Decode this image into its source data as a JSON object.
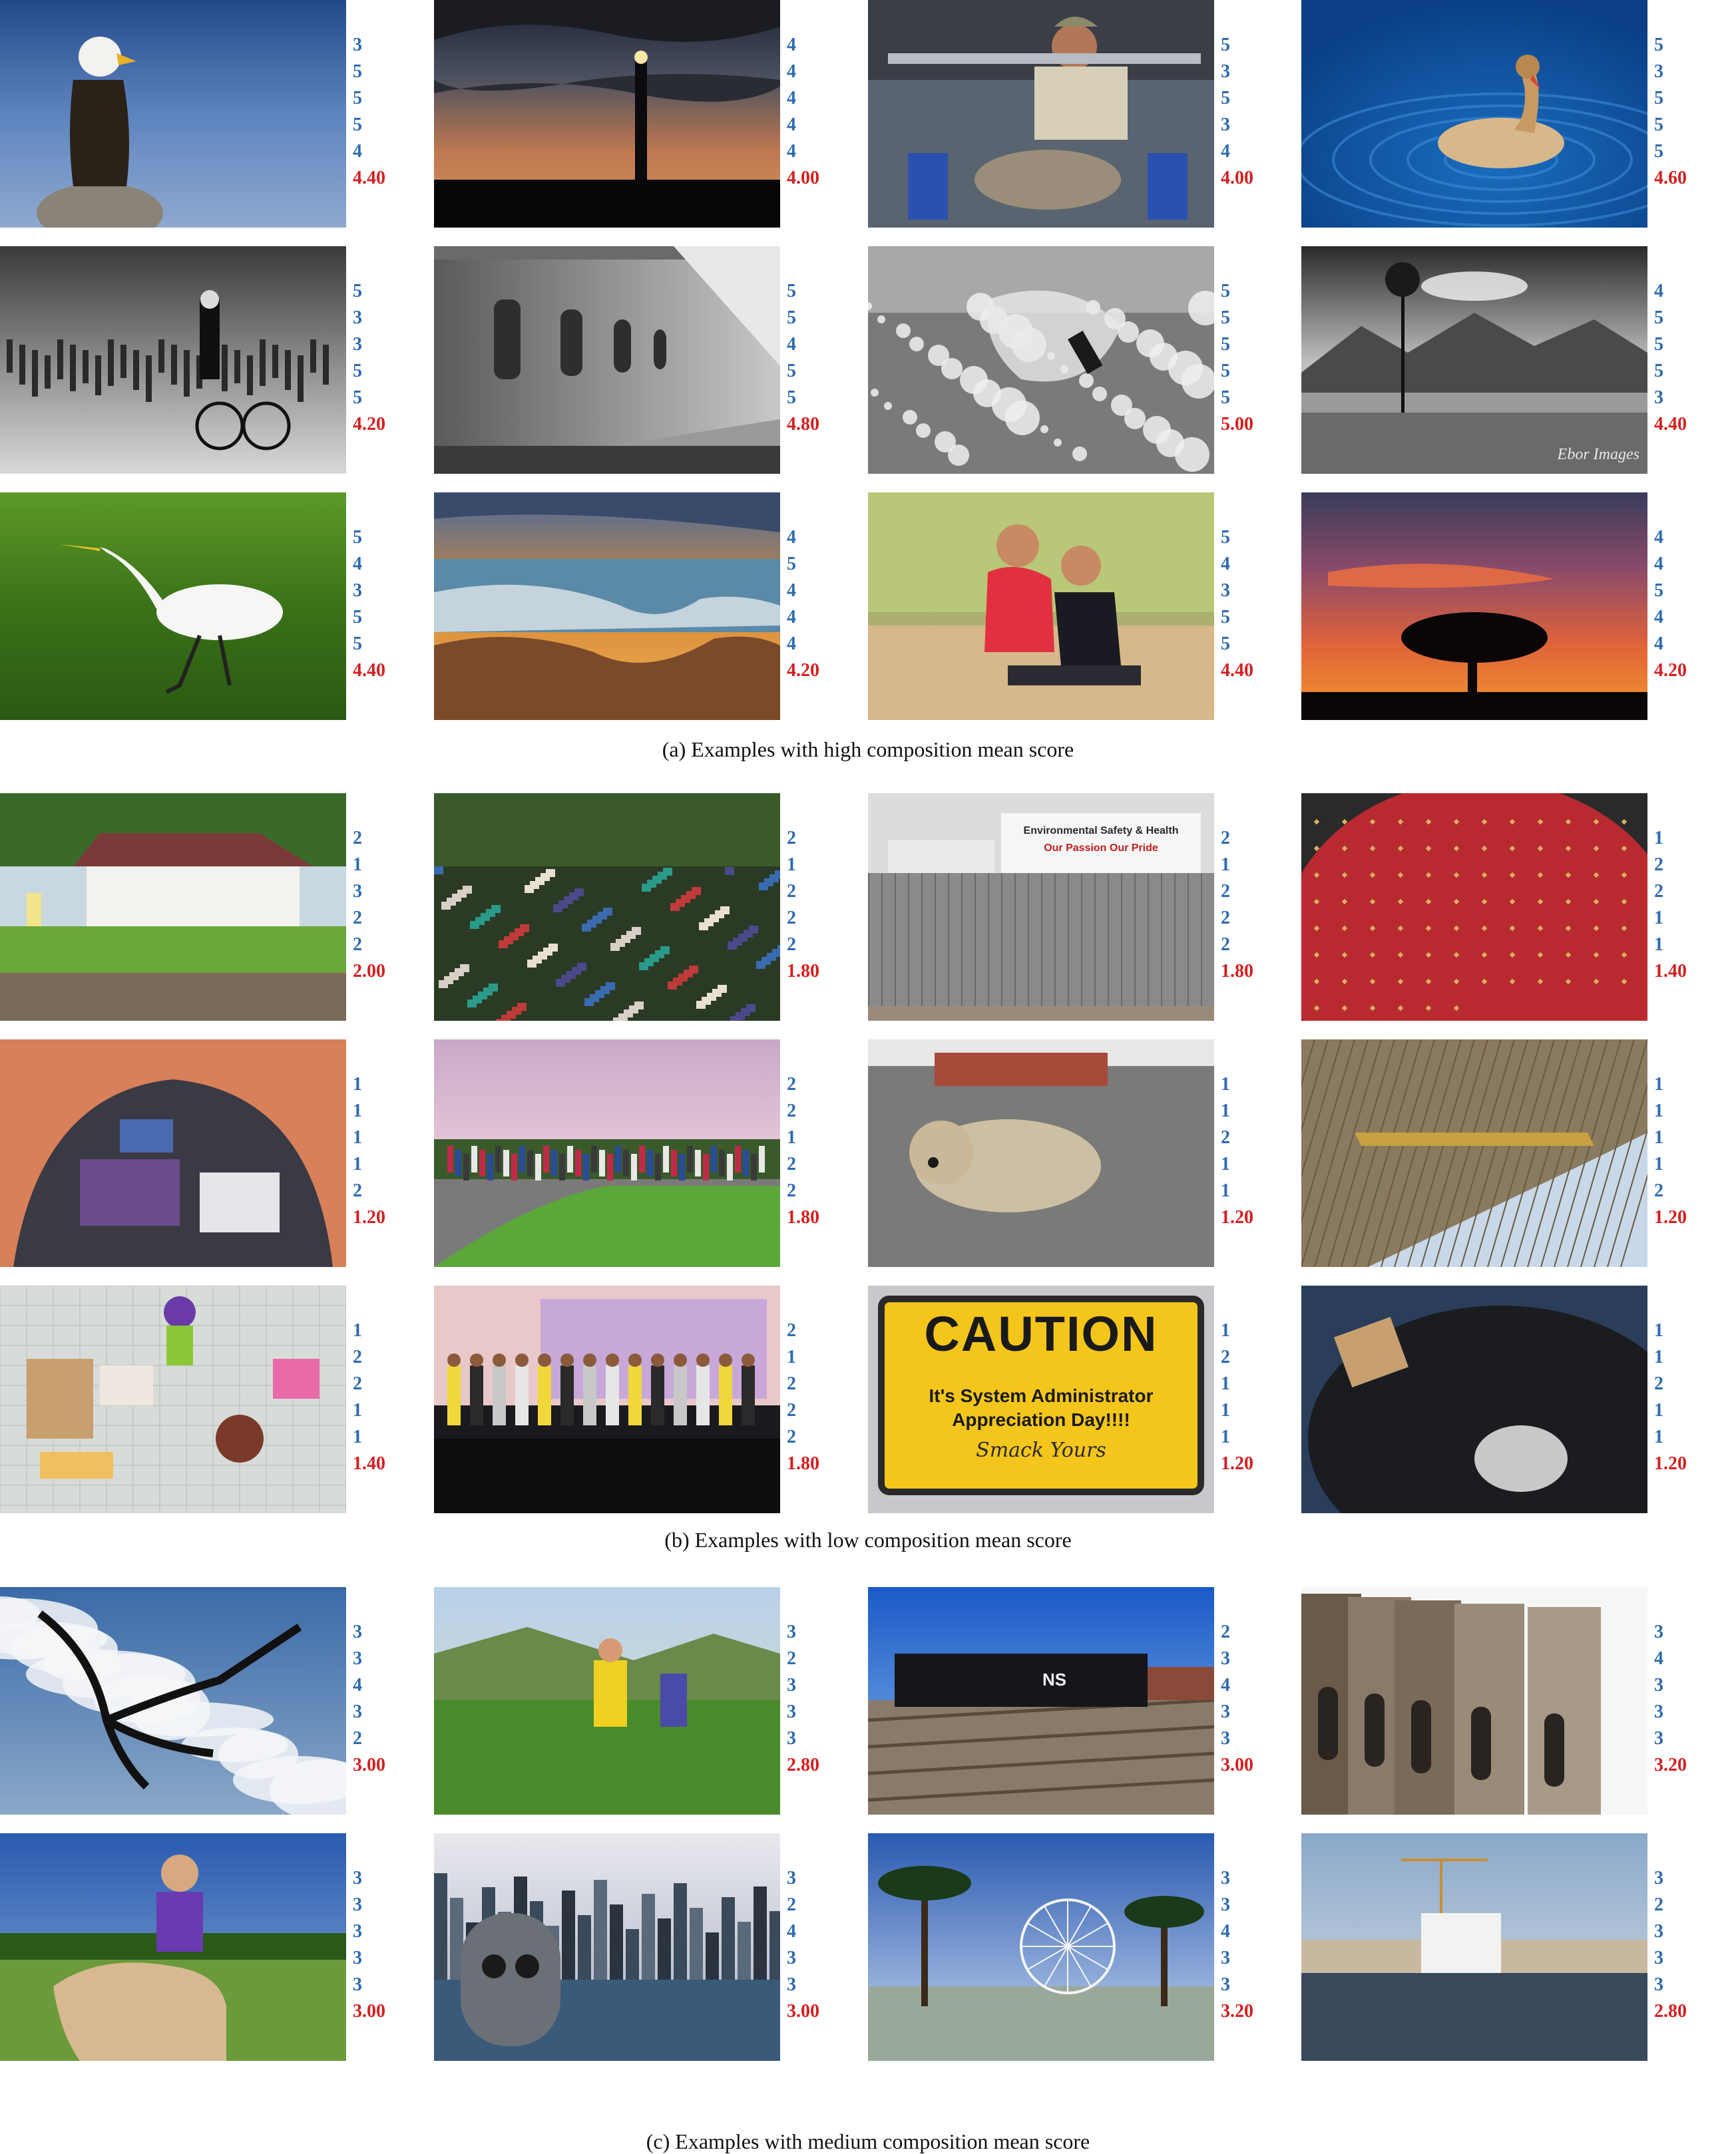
{
  "sections": [
    {
      "caption": "(a) Examples with high composition mean score",
      "rows": [
        [
          {
            "scene": "bald-eagle-on-rock",
            "scores": [
              "3",
              "5",
              "5",
              "5",
              "4"
            ],
            "mean": "4.40"
          },
          {
            "scene": "lighthouse-at-dusk",
            "scores": [
              "4",
              "4",
              "4",
              "4",
              "4"
            ],
            "mean": "4.00"
          },
          {
            "scene": "man-at-rowing-machine",
            "scores": [
              "5",
              "3",
              "5",
              "3",
              "4"
            ],
            "mean": "4.00"
          },
          {
            "scene": "duck-on-blue-water",
            "scores": [
              "5",
              "3",
              "5",
              "5",
              "5"
            ],
            "mean": "4.60"
          }
        ],
        [
          {
            "scene": "street-crowd-cyclist-bw",
            "scores": [
              "5",
              "3",
              "3",
              "5",
              "5"
            ],
            "mean": "4.20"
          },
          {
            "scene": "stone-building-perspective-bw",
            "scores": [
              "5",
              "5",
              "4",
              "5",
              "5"
            ],
            "mean": "4.80"
          },
          {
            "scene": "surfer-splash-bw",
            "scores": [
              "5",
              "5",
              "5",
              "5",
              "5"
            ],
            "mean": "5.00"
          },
          {
            "scene": "lone-tree-mountains-bw",
            "scores": [
              "4",
              "5",
              "5",
              "5",
              "3"
            ],
            "mean": "4.40"
          }
        ],
        [
          {
            "scene": "white-egret-on-grass",
            "scores": [
              "5",
              "4",
              "3",
              "5",
              "5"
            ],
            "mean": "4.40"
          },
          {
            "scene": "rocky-coast-sunset",
            "scores": [
              "4",
              "5",
              "4",
              "4",
              "4"
            ],
            "mean": "4.20"
          },
          {
            "scene": "mother-and-son-on-beach",
            "scores": [
              "5",
              "4",
              "3",
              "5",
              "5"
            ],
            "mean": "4.40"
          },
          {
            "scene": "acacia-tree-sunset",
            "scores": [
              "4",
              "4",
              "5",
              "4",
              "4"
            ],
            "mean": "4.20"
          }
        ]
      ]
    },
    {
      "caption": "(b) Examples with low composition mean score",
      "rows": [
        [
          {
            "scene": "white-house-and-fence",
            "scores": [
              "2",
              "1",
              "3",
              "2",
              "2"
            ],
            "mean": "2.00"
          },
          {
            "scene": "crowd-in-park",
            "scores": [
              "2",
              "1",
              "2",
              "2",
              "2"
            ],
            "mean": "1.80"
          },
          {
            "scene": "construction-hoarding-signs",
            "scores": [
              "2",
              "1",
              "2",
              "2",
              "2"
            ],
            "mean": "1.80"
          },
          {
            "scene": "red-fabric-closeup",
            "scores": [
              "1",
              "2",
              "2",
              "1",
              "1"
            ],
            "mean": "1.40"
          }
        ],
        [
          {
            "scene": "inside-tent-view",
            "scores": [
              "1",
              "1",
              "1",
              "1",
              "2"
            ],
            "mean": "1.20"
          },
          {
            "scene": "crowd-on-road",
            "scores": [
              "2",
              "2",
              "1",
              "2",
              "2"
            ],
            "mean": "1.80"
          },
          {
            "scene": "blurry-dog",
            "scores": [
              "1",
              "1",
              "2",
              "1",
              "1"
            ],
            "mean": "1.20"
          },
          {
            "scene": "underside-of-structure",
            "scores": [
              "1",
              "1",
              "1",
              "1",
              "2"
            ],
            "mean": "1.20"
          }
        ],
        [
          {
            "scene": "craft-items-on-mat",
            "scores": [
              "1",
              "2",
              "2",
              "1",
              "1"
            ],
            "mean": "1.40"
          },
          {
            "scene": "conference-stage",
            "scores": [
              "2",
              "1",
              "2",
              "2",
              "2"
            ],
            "mean": "1.80"
          },
          {
            "scene": "caution-sign",
            "scores": [
              "1",
              "2",
              "1",
              "1",
              "1"
            ],
            "mean": "1.20"
          },
          {
            "scene": "charcoal-grill-closeup",
            "scores": [
              "1",
              "1",
              "2",
              "1",
              "1"
            ],
            "mean": "1.20"
          }
        ]
      ]
    },
    {
      "caption": "(c) Examples with medium composition mean score",
      "rows": [
        [
          {
            "scene": "bird-sculpture-against-clouds",
            "scores": [
              "3",
              "3",
              "4",
              "3",
              "2"
            ],
            "mean": "3.00"
          },
          {
            "scene": "trail-runners-on-hill",
            "scores": [
              "3",
              "2",
              "3",
              "3",
              "3"
            ],
            "mean": "2.80"
          },
          {
            "scene": "locomotive-on-tracks",
            "scores": [
              "2",
              "3",
              "4",
              "3",
              "3"
            ],
            "mean": "3.00"
          },
          {
            "scene": "stone-castle-towers",
            "scores": [
              "3",
              "4",
              "3",
              "3",
              "3"
            ],
            "mean": "3.20"
          }
        ],
        [
          {
            "scene": "woman-on-horse",
            "scores": [
              "3",
              "3",
              "3",
              "3",
              "3"
            ],
            "mean": "3.00"
          },
          {
            "scene": "city-skyline-binocular-viewer",
            "scores": [
              "3",
              "2",
              "4",
              "3",
              "3"
            ],
            "mean": "3.00"
          },
          {
            "scene": "ferris-wheel-and-palms",
            "scores": [
              "3",
              "3",
              "4",
              "3",
              "3"
            ],
            "mean": "3.20"
          },
          {
            "scene": "waterfront-buildings",
            "scores": [
              "3",
              "2",
              "3",
              "3",
              "3"
            ],
            "mean": "2.80"
          }
        ]
      ]
    }
  ],
  "photo_text": {
    "watermark": "Ebor Images",
    "caution_title": "CAUTION",
    "caution_line1": "It's System Administrator",
    "caution_line2": "Appreciation Day!!!!",
    "caution_line3": "Smack Yours",
    "banner1": "Environmental Safety & Health",
    "banner2": "Our Passion Our Pride",
    "train_logo": "NS"
  }
}
